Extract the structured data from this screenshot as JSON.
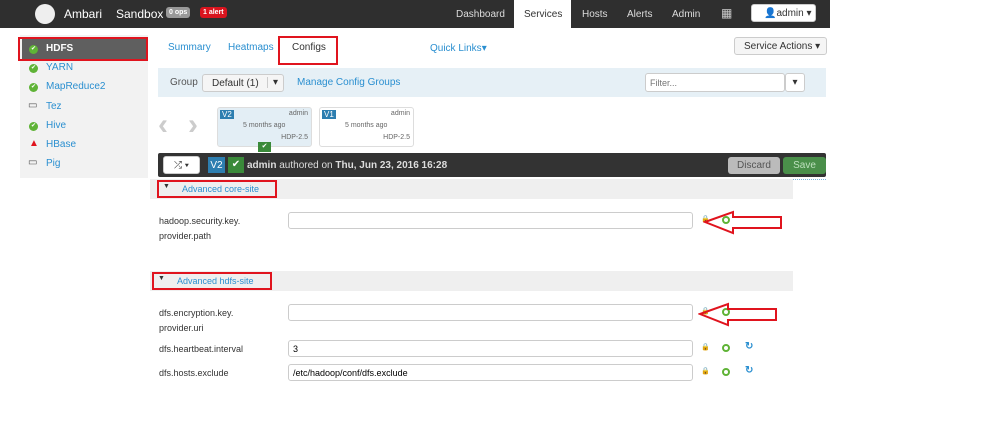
{
  "nav": {
    "brand": "Ambari",
    "cluster": "Sandbox",
    "ops": "0 ops",
    "alerts": "1 alert",
    "items": [
      "Dashboard",
      "Services",
      "Hosts",
      "Alerts",
      "Admin"
    ],
    "user": "admin"
  },
  "sidebar": {
    "items": [
      {
        "label": "HDFS",
        "status": "ok"
      },
      {
        "label": "YARN",
        "status": "ok"
      },
      {
        "label": "MapReduce2",
        "status": "ok"
      },
      {
        "label": "Tez",
        "status": "client"
      },
      {
        "label": "Hive",
        "status": "ok"
      },
      {
        "label": "HBase",
        "status": "alert"
      },
      {
        "label": "Pig",
        "status": "client"
      }
    ]
  },
  "tabs": {
    "summary": "Summary",
    "heatmaps": "Heatmaps",
    "configs": "Configs",
    "quick_links": "Quick Links",
    "service_actions": "Service Actions"
  },
  "group": {
    "label": "Group",
    "value": "Default (1)",
    "manage": "Manage Config Groups",
    "filter_placeholder": "Filter..."
  },
  "versions": [
    {
      "v": "V2",
      "user": "admin",
      "ago": "5 months ago",
      "stack": "HDP-2.5",
      "current": true
    },
    {
      "v": "V1",
      "user": "admin",
      "ago": "5 months ago",
      "stack": "HDP-2.5",
      "current": false
    }
  ],
  "bar": {
    "version": "V2",
    "author": "admin",
    "authored": "authored on",
    "date": "Thu, Jun 23, 2016 16:28",
    "discard": "Discard",
    "save": "Save"
  },
  "sections": [
    {
      "title": "Advanced core-site",
      "props": [
        {
          "name1": "hadoop.security.key.",
          "name2": "provider.path",
          "value": ""
        }
      ]
    },
    {
      "title": "Advanced hdfs-site",
      "props": [
        {
          "name1": "dfs.encryption.key.",
          "name2": "provider.uri",
          "value": ""
        },
        {
          "name1": "dfs.heartbeat.interval",
          "name2": "",
          "value": "3"
        },
        {
          "name1": "dfs.hosts.exclude",
          "name2": "",
          "value": "/etc/hadoop/conf/dfs.exclude"
        }
      ]
    }
  ],
  "colors": {
    "ok": "#5fb336",
    "alert": "#e0141e",
    "link": "#2a8fd0",
    "annotation": "#e0141e"
  }
}
